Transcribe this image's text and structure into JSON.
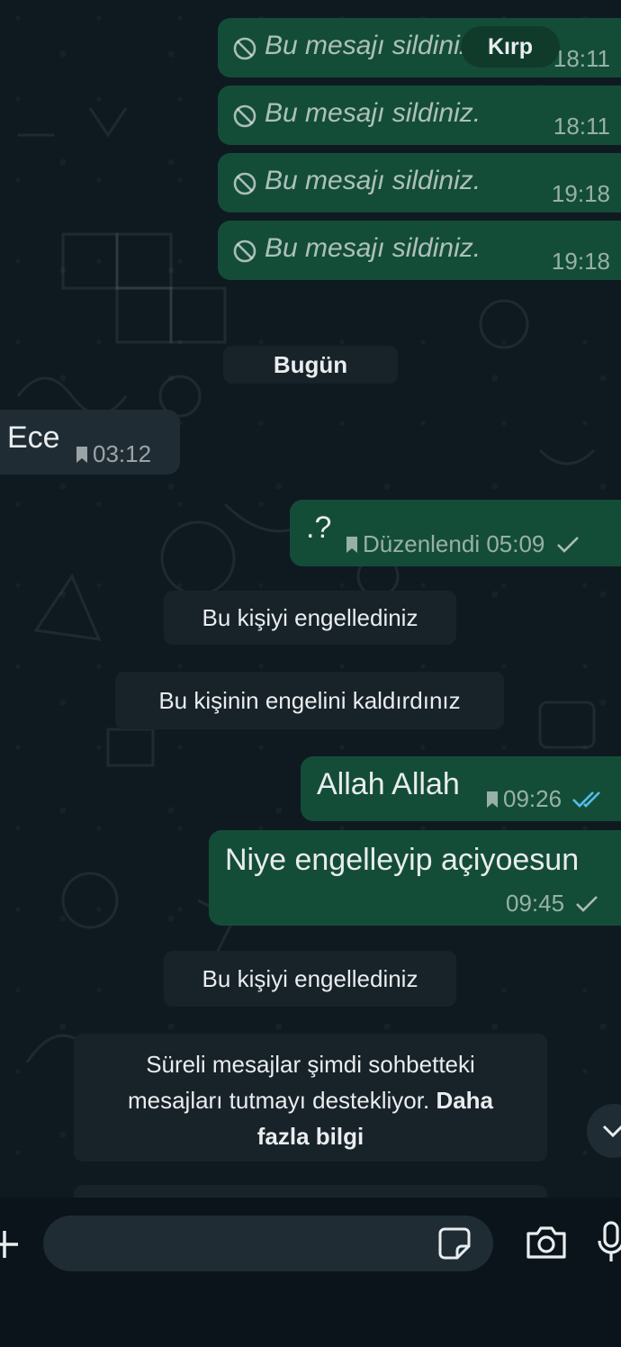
{
  "colors": {
    "background": "#0b141a",
    "outgoing_bubble": "#144d37",
    "incoming_bubble": "#202c33",
    "system_chip": "#182229",
    "read_ticks": "#53bdeb"
  },
  "deleted_messages": [
    {
      "text": "Bu mesajı sildiniz.",
      "time": "18:11"
    },
    {
      "text": "Bu mesajı sildiniz.",
      "time": "18:11"
    },
    {
      "text": "Bu mesajı sildiniz.",
      "time": "19:18"
    },
    {
      "text": "Bu mesajı sildiniz.",
      "time": "19:18"
    }
  ],
  "crop_tooltip": "Kırp",
  "date_separator": "Bugün",
  "incoming_message": {
    "text": "Ece",
    "time": "03:12",
    "icon": "bookmark-icon"
  },
  "edited_message": {
    "text": ".?",
    "status": "Düzenlendi 05:09",
    "icon": "check-icon"
  },
  "system_messages": {
    "blocked_1": "Bu kişiyi engellediniz",
    "unblocked": "Bu kişinin engelini kaldırdınız",
    "blocked_2": "Bu kişiyi engellediniz"
  },
  "outgoing_messages": [
    {
      "text": "Allah Allah",
      "time": "09:26",
      "ticks": "double-check-icon"
    },
    {
      "text": "Niye engelleyip açiyoesun",
      "time": "09:45",
      "ticks": "check-icon"
    }
  ],
  "disappearing_notice": {
    "line1": "Süreli mesajlar şimdi sohbetteki",
    "line2": "mesajları tutmayı destekliyor.",
    "link": "Daha",
    "line3": "fazla bilgi"
  },
  "composer": {
    "icons": [
      "plus-icon",
      "sticker-icon",
      "camera-icon",
      "microphone-icon"
    ],
    "scroll_icon": "chevron-down-icon"
  }
}
